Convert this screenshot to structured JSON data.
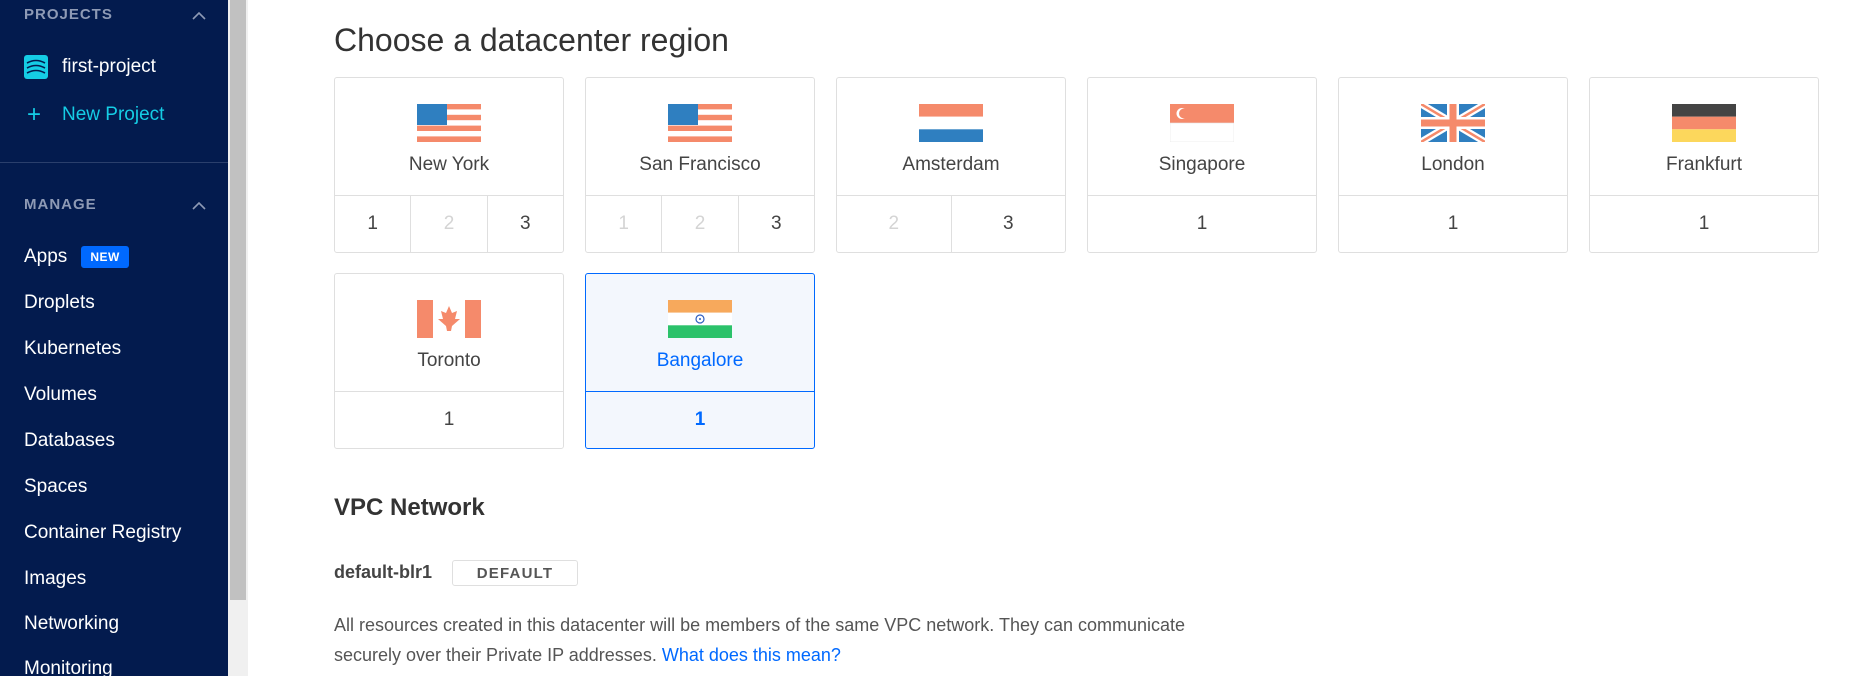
{
  "sidebar": {
    "projects_title": "PROJECTS",
    "project_name": "first-project",
    "new_project_label": "New Project",
    "manage_title": "MANAGE",
    "items": [
      {
        "label": "Apps",
        "badge": "NEW"
      },
      {
        "label": "Droplets"
      },
      {
        "label": "Kubernetes"
      },
      {
        "label": "Volumes"
      },
      {
        "label": "Databases"
      },
      {
        "label": "Spaces"
      },
      {
        "label": "Container Registry"
      },
      {
        "label": "Images"
      },
      {
        "label": "Networking"
      },
      {
        "label": "Monitoring"
      }
    ]
  },
  "main": {
    "title": "Choose a datacenter region",
    "regions": [
      {
        "name": "New York",
        "flag": "usa-flag-icon",
        "datacenters": [
          "1",
          "2",
          "3"
        ],
        "disabled": [
          false,
          true,
          false
        ]
      },
      {
        "name": "San Francisco",
        "flag": "usa-flag-icon",
        "datacenters": [
          "1",
          "2",
          "3"
        ],
        "disabled": [
          true,
          true,
          false
        ]
      },
      {
        "name": "Amsterdam",
        "flag": "netherlands-flag-icon",
        "datacenters": [
          "2",
          "3"
        ],
        "disabled": [
          true,
          false
        ]
      },
      {
        "name": "Singapore",
        "flag": "singapore-flag-icon",
        "datacenters": [
          "1"
        ],
        "disabled": [
          false
        ]
      },
      {
        "name": "London",
        "flag": "uk-flag-icon",
        "datacenters": [
          "1"
        ],
        "disabled": [
          false
        ]
      },
      {
        "name": "Frankfurt",
        "flag": "germany-flag-icon",
        "datacenters": [
          "1"
        ],
        "disabled": [
          false
        ]
      },
      {
        "name": "Toronto",
        "flag": "canada-flag-icon",
        "datacenters": [
          "1"
        ],
        "disabled": [
          false
        ]
      },
      {
        "name": "Bangalore",
        "flag": "india-flag-icon",
        "datacenters": [
          "1"
        ],
        "disabled": [
          false
        ],
        "selected": true
      }
    ]
  },
  "vpc": {
    "title": "VPC Network",
    "name": "default-blr1",
    "badge": "DEFAULT",
    "description": "All resources created in this datacenter will be members of the same VPC network. They can communicate securely over their Private IP addresses.",
    "link": "What does this mean?"
  },
  "colors": {
    "sidebar_bg": "#031b4e",
    "accent": "#0069ff",
    "new_project": "#15cde5"
  }
}
